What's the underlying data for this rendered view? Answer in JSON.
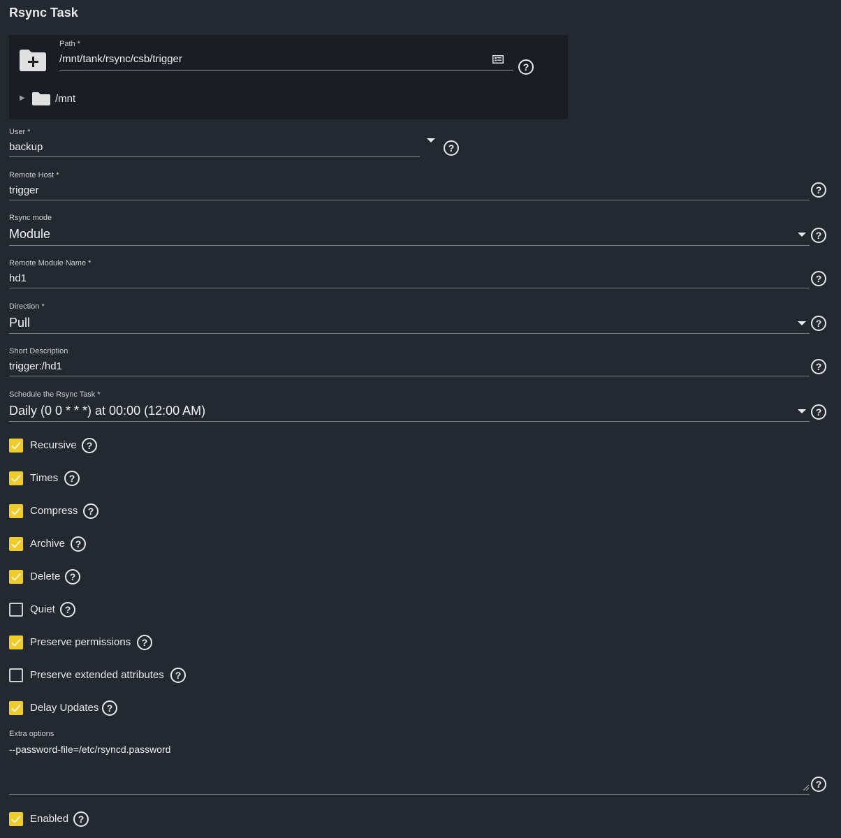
{
  "page": {
    "title": "Rsync Task"
  },
  "path": {
    "label": "Path *",
    "value": "/mnt/tank/rsync/csb/trigger",
    "tree_root": "/mnt"
  },
  "fields": {
    "user": {
      "label": "User *",
      "value": "backup"
    },
    "remote_host": {
      "label": "Remote Host *",
      "value": "trigger"
    },
    "rsync_mode": {
      "label": "Rsync mode",
      "value": "Module"
    },
    "remote_module": {
      "label": "Remote Module Name *",
      "value": "hd1"
    },
    "direction": {
      "label": "Direction *",
      "value": "Pull"
    },
    "description": {
      "label": "Short Description",
      "value": "trigger:/hd1"
    },
    "schedule": {
      "label": "Schedule the Rsync Task *",
      "value": "Daily (0 0 * * *) at 00:00 (12:00 AM)"
    },
    "extra": {
      "label": "Extra options",
      "value": "--password-file=/etc/rsyncd.password"
    }
  },
  "checkboxes": [
    {
      "label": "Recursive",
      "checked": true
    },
    {
      "label": "Times",
      "checked": true
    },
    {
      "label": "Compress",
      "checked": true
    },
    {
      "label": "Archive",
      "checked": true
    },
    {
      "label": "Delete",
      "checked": true
    },
    {
      "label": "Quiet",
      "checked": false
    },
    {
      "label": "Preserve permissions",
      "checked": true
    },
    {
      "label": "Preserve extended attributes",
      "checked": false
    },
    {
      "label": "Delay Updates",
      "checked": true
    }
  ],
  "enabled": {
    "label": "Enabled",
    "checked": true
  },
  "help_glyph": "?",
  "colors": {
    "background": "#232931",
    "panel": "#1a1e24",
    "accent": "#f0cb2c"
  }
}
